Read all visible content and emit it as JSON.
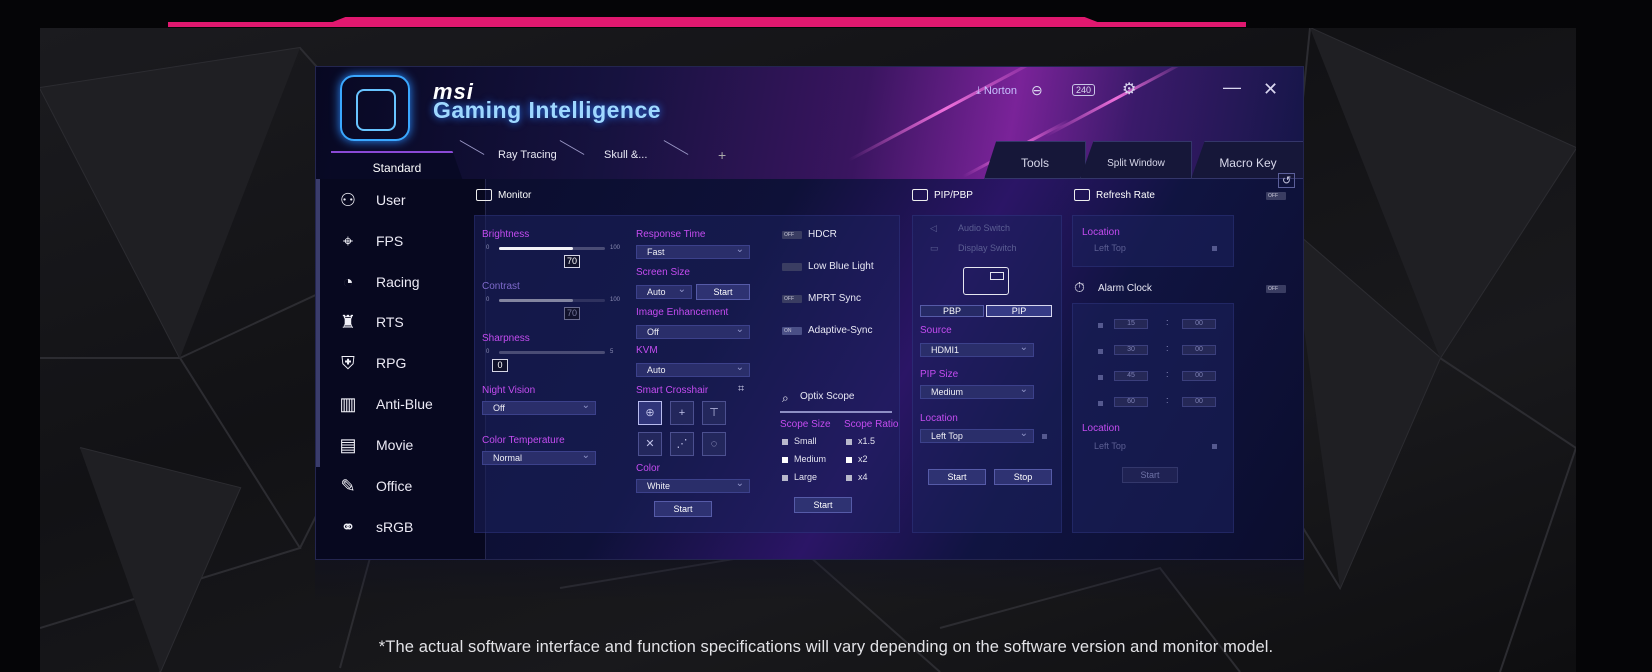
{
  "brand": "msi",
  "app_title": "Gaming Intelligence",
  "header": {
    "norton_label": "Norton",
    "hz_badge": "240"
  },
  "tabs": {
    "standard": "Standard",
    "ray": "Ray Tracing",
    "skull": "Skull &...",
    "plus": "+"
  },
  "right_tabs": {
    "tools": "Tools",
    "split": "Split Window",
    "macro": "Macro Key"
  },
  "sidebar": {
    "items": [
      {
        "label": "User",
        "icon": "user-icon"
      },
      {
        "label": "FPS",
        "icon": "crosshair-icon"
      },
      {
        "label": "Racing",
        "icon": "speedometer-icon"
      },
      {
        "label": "RTS",
        "icon": "chess-icon"
      },
      {
        "label": "RPG",
        "icon": "helmet-icon"
      },
      {
        "label": "Anti-Blue",
        "icon": "book-icon"
      },
      {
        "label": "Movie",
        "icon": "film-icon"
      },
      {
        "label": "Office",
        "icon": "pen-icon"
      },
      {
        "label": "sRGB",
        "icon": "rgb-circles-icon"
      }
    ]
  },
  "monitor": {
    "title": "Monitor",
    "brightness": {
      "label": "Brightness",
      "min": "0",
      "max": "100",
      "value": "70",
      "fraction": 0.7
    },
    "contrast": {
      "label": "Contrast",
      "min": "0",
      "max": "100",
      "value": "70",
      "fraction": 0.7
    },
    "sharpness": {
      "label": "Sharpness",
      "min": "0",
      "max": "5",
      "value": "0",
      "fraction": 0
    },
    "night_vision": {
      "label": "Night Vision",
      "value": "Off"
    },
    "color_temperature": {
      "label": "Color Temperature",
      "value": "Normal"
    },
    "response_time": {
      "label": "Response Time",
      "value": "Fast"
    },
    "screen_size": {
      "label": "Screen Size",
      "value": "Auto",
      "button": "Start"
    },
    "image_enhancement": {
      "label": "Image Enhancement",
      "value": "Off"
    },
    "kvm": {
      "label": "KVM",
      "value": "Auto"
    },
    "smart_crosshair": {
      "label": "Smart Crosshair"
    },
    "color": {
      "label": "Color",
      "value": "White"
    },
    "start_button": "Start",
    "toggles": [
      {
        "label": "HDCR",
        "state": "OFF"
      },
      {
        "label": "Low Blue Light",
        "state": ""
      },
      {
        "label": "MPRT Sync",
        "state": "OFF"
      },
      {
        "label": "Adaptive-Sync",
        "state": "ON"
      }
    ],
    "optix": {
      "title": "Optix Scope",
      "size_label": "Scope Size",
      "ratio_label": "Scope Ratio",
      "sizes": [
        "Small",
        "Medium",
        "Large"
      ],
      "ratios": [
        "x1.5",
        "x2",
        "x4"
      ],
      "selected_size": "Medium",
      "selected_ratio": "x2",
      "start": "Start"
    }
  },
  "pip": {
    "title": "PIP/PBP",
    "audio_switch": "Audio Switch",
    "display_switch": "Display Switch",
    "pbp": "PBP",
    "pip": "PIP",
    "source_label": "Source",
    "source_value": "HDMI1",
    "size_label": "PIP Size",
    "size_value": "Medium",
    "location_label": "Location",
    "location_value": "Left Top",
    "start": "Start",
    "stop": "Stop"
  },
  "refresh": {
    "title": "Refresh Rate",
    "toggle": "OFF",
    "location_label": "Location",
    "location_value": "Left Top"
  },
  "alarm": {
    "title": "Alarm Clock",
    "toggle": "OFF",
    "rows": [
      {
        "min": "15",
        "sec": "00"
      },
      {
        "min": "30",
        "sec": "00"
      },
      {
        "min": "45",
        "sec": "00"
      },
      {
        "min": "60",
        "sec": "00"
      }
    ],
    "location_label": "Location",
    "location_value": "Left Top",
    "start": "Start"
  },
  "disclaimer": "*The actual software interface and function specifications will vary depending on the software version and monitor model.",
  "colors": {
    "accent": "#c44cf0",
    "brand_pink": "#e0186f",
    "title_blue": "#9fd8ff"
  }
}
